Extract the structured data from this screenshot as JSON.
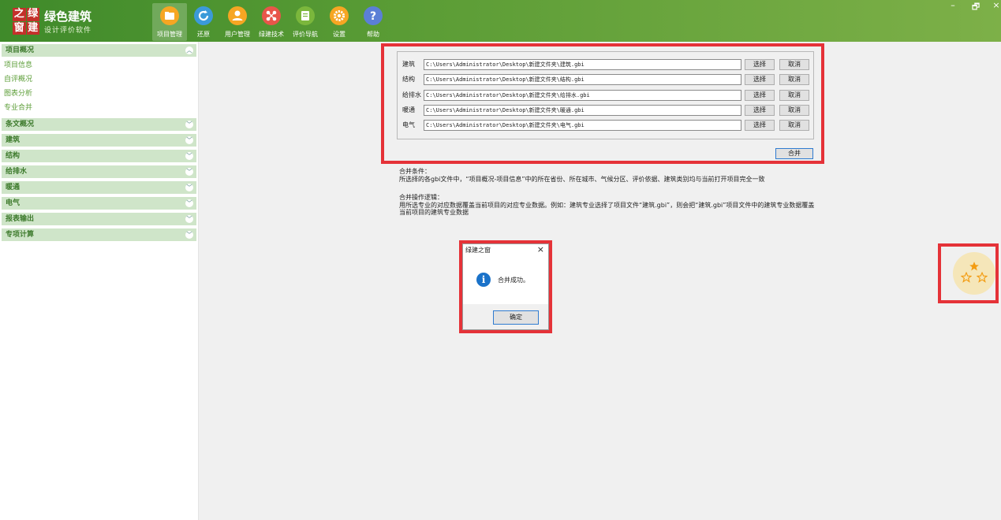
{
  "app": {
    "logo_chars": [
      "之",
      "绿",
      "窗",
      "建"
    ],
    "title": "绿色建筑",
    "subtitle": "设计评价软件"
  },
  "toolbar": [
    {
      "label": "项目管理",
      "icon": "folder-icon",
      "color": "#f6a623"
    },
    {
      "label": "还原",
      "icon": "restore-icon",
      "color": "#3b9ad9"
    },
    {
      "label": "用户管理",
      "icon": "user-icon",
      "color": "#f6a623"
    },
    {
      "label": "绿建技术",
      "icon": "tech-icon",
      "color": "#e8564a"
    },
    {
      "label": "评价导航",
      "icon": "book-icon",
      "color": "#7bb73c"
    },
    {
      "label": "设置",
      "icon": "gear-icon",
      "color": "#f6a623"
    },
    {
      "label": "帮助",
      "icon": "help-icon",
      "color": "#5b7fd6"
    }
  ],
  "window_controls": [
    "–",
    "🗗",
    "×"
  ],
  "sidebar": {
    "sections": [
      {
        "label": "项目概况",
        "expanded": true,
        "items": [
          "项目信息",
          "自评概况",
          "图表分析",
          "专业合并"
        ]
      },
      {
        "label": "条文概况"
      },
      {
        "label": "建筑"
      },
      {
        "label": "结构"
      },
      {
        "label": "给排水"
      },
      {
        "label": "暖通"
      },
      {
        "label": "电气"
      },
      {
        "label": "报表输出"
      },
      {
        "label": "专项计算"
      }
    ]
  },
  "merge": {
    "rows": [
      {
        "label": "建筑",
        "path": "C:\\Users\\Administrator\\Desktop\\新建文件夹\\建筑.gbi"
      },
      {
        "label": "结构",
        "path": "C:\\Users\\Administrator\\Desktop\\新建文件夹\\结构.gbi"
      },
      {
        "label": "给排水",
        "path": "C:\\Users\\Administrator\\Desktop\\新建文件夹\\给排水.gbi"
      },
      {
        "label": "暖通",
        "path": "C:\\Users\\Administrator\\Desktop\\新建文件夹\\暖通.gbi"
      },
      {
        "label": "电气",
        "path": "C:\\Users\\Administrator\\Desktop\\新建文件夹\\电气.gbi"
      }
    ],
    "select_label": "选择",
    "cancel_label": "取消",
    "merge_label": "合并"
  },
  "notes": {
    "condition_title": "合并条件：",
    "condition_text": "所选择的各gbi文件中，“项目概况-项目信息”中的所在省份、所在城市、气候分区、评价依据、建筑类别均与当前打开项目完全一致",
    "logic_title": "合并操作逻辑：",
    "logic_text": "用所选专业的对应数据覆盖当前项目的对应专业数据。例如：建筑专业选择了项目文件“建筑.gbi”，则会把“建筑.gbi”项目文件中的建筑专业数据覆盖当前项目的建筑专业数据"
  },
  "dialog": {
    "title": "绿建之窗",
    "close": "×",
    "message": "合并成功。",
    "ok_label": "确定",
    "info_glyph": "i"
  },
  "colors": {
    "highlight": "#e53238",
    "accent_green": "#5a9c35"
  }
}
